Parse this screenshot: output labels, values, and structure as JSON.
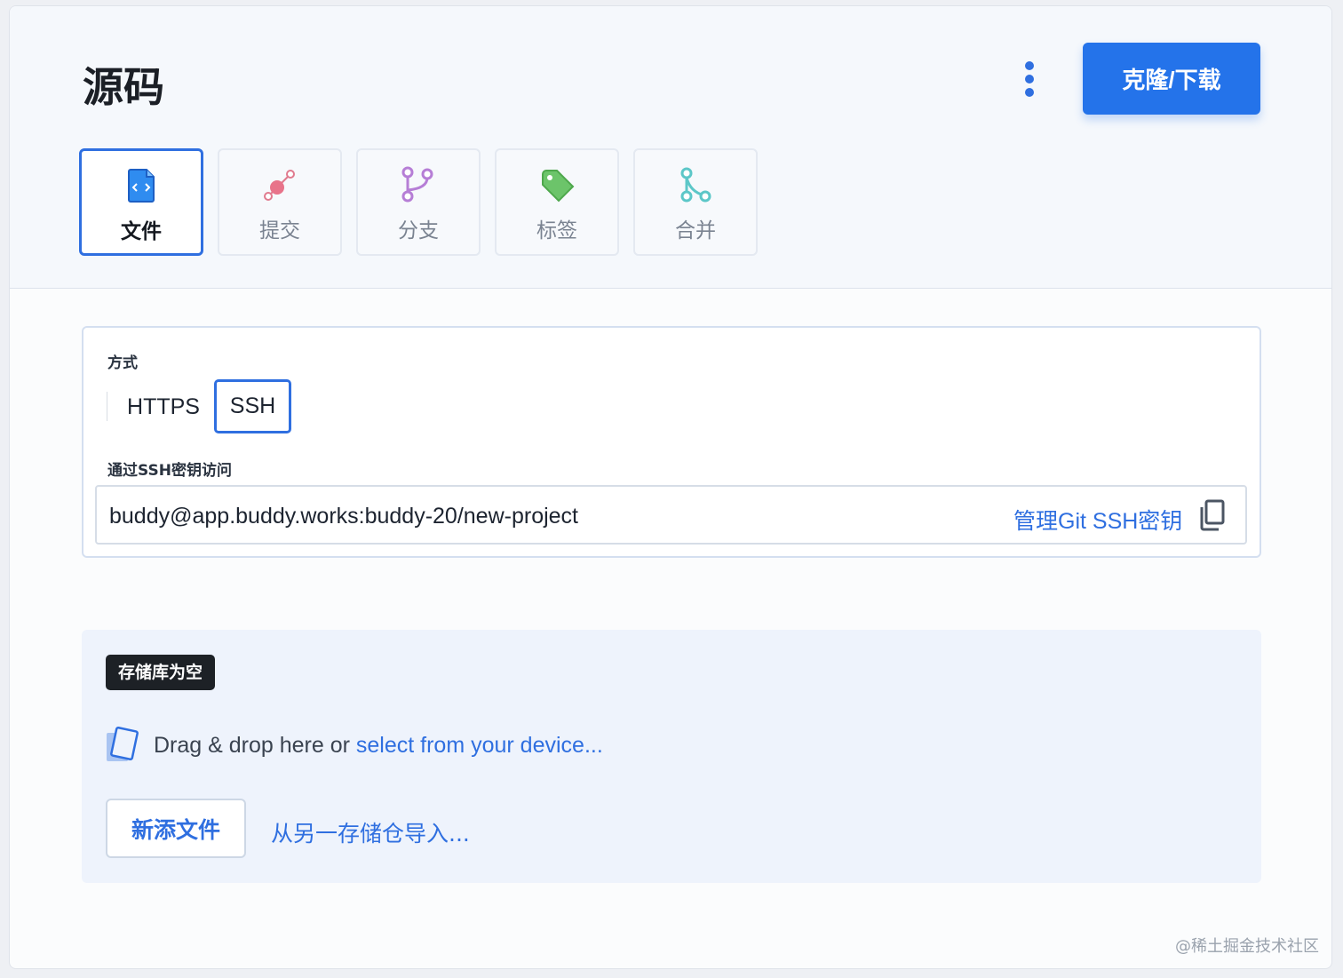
{
  "header": {
    "title": "源码",
    "menu_icon": "kebab-menu-icon",
    "clone_button": "克隆/下载"
  },
  "tabs": [
    {
      "label": "文件",
      "icon": "file-code-icon",
      "active": true
    },
    {
      "label": "提交",
      "icon": "commit-icon",
      "active": false
    },
    {
      "label": "分支",
      "icon": "branch-icon",
      "active": false
    },
    {
      "label": "标签",
      "icon": "tag-icon",
      "active": false
    },
    {
      "label": "合并",
      "icon": "merge-icon",
      "active": false
    }
  ],
  "method": {
    "label": "方式",
    "options": [
      "HTTPS",
      "SSH"
    ],
    "selected": "SSH",
    "access_label": "通过SSH密钥访问",
    "url": "buddy@app.buddy.works:buddy-20/new-project",
    "manage_link": "管理Git SSH密钥",
    "copy_icon": "copy-icon"
  },
  "empty_repo": {
    "badge": "存储库为空",
    "drop_icon": "file-drop-icon",
    "drop_text": "Drag & drop here or ",
    "select_link": "select from your device...",
    "new_file_button": "新添文件",
    "import_link": "从另一存储仓导入..."
  },
  "watermark": "@稀土掘金技术社区",
  "colors": {
    "accent": "#2f6fe0",
    "primary_button": "#2473ea",
    "badge_bg": "#1d2126",
    "header_bg": "#f5f8fc",
    "empty_panel_bg": "#eef3fc"
  }
}
